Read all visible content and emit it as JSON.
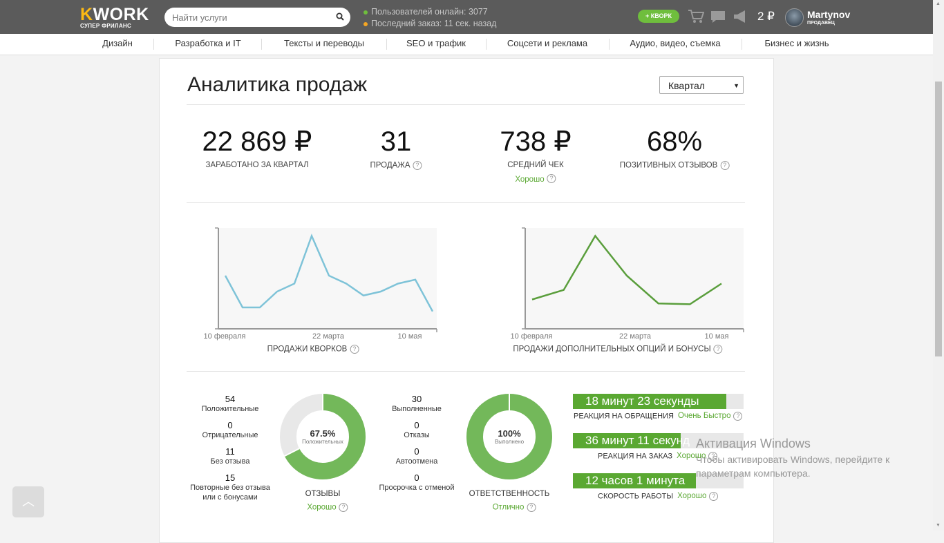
{
  "header": {
    "logo_text": "KWORK",
    "logo_tagline": "СУПЕР ФРИЛАНС",
    "search_placeholder": "Найти услуги",
    "online_text": "Пользователей онлайн: 3077",
    "last_order_text": "Последний заказ: 11 сек. назад",
    "kwork_button": "+ КВОРК",
    "balance": "2 ₽",
    "username": "Martynov",
    "user_role": "ПРОДАВЕЦ",
    "colors": {
      "online_dot": "#6fbe3d",
      "order_dot": "#f5a623",
      "accent": "#6fbe3d"
    }
  },
  "categories": [
    "Дизайн",
    "Разработка и IT",
    "Тексты и переводы",
    "SEO и трафик",
    "Соцсети и реклама",
    "Аудио, видео, съемка",
    "Бизнес и жизнь"
  ],
  "page": {
    "title": "Аналитика продаж",
    "period_select": "Квартал"
  },
  "stats": [
    {
      "value": "22 869 ₽",
      "label": "ЗАРАБОТАНО ЗА КВАРТАЛ",
      "help": false,
      "note": ""
    },
    {
      "value": "31",
      "label": "ПРОДАЖА",
      "help": true,
      "note": ""
    },
    {
      "value": "738 ₽",
      "label": "СРЕДНИЙ ЧЕК",
      "help": false,
      "note": "Хорошо"
    },
    {
      "value": "68%",
      "label": "ПОЗИТИВНЫХ ОТЗЫВОВ",
      "help": true,
      "note": ""
    }
  ],
  "chart_data": [
    {
      "type": "line",
      "title": "ПРОДАЖИ КВОРКОВ",
      "x_tick_labels": [
        "10 февраля",
        "22 марта",
        "10 мая"
      ],
      "values": [
        6,
        2,
        2,
        4,
        5,
        11,
        6,
        5,
        3.5,
        4,
        5,
        5.5,
        1.5
      ],
      "color": "#7ec3d8"
    },
    {
      "type": "line",
      "title": "ПРОДАЖИ ДОПОЛНИТЕЛЬНЫХ ОПЦИЙ И БОНУСЫ",
      "x_tick_labels": [
        "10 февраля",
        "22 марта",
        "10 мая"
      ],
      "values": [
        3,
        4.2,
        11,
        6,
        2.5,
        2.4,
        5
      ],
      "color": "#5a9e3c"
    }
  ],
  "reviews": {
    "items": [
      {
        "value": "54",
        "label": "Положительные"
      },
      {
        "value": "0",
        "label": "Отрицательные"
      },
      {
        "value": "11",
        "label": "Без отзыва"
      },
      {
        "value": "15",
        "label": "Повторные без отзыва",
        "label2": "или с бонусами"
      }
    ],
    "donut_percent": "67.5%",
    "donut_sublabel": "Положительных",
    "donut_fraction": 0.675,
    "caption": "ОТЗЫВЫ",
    "rating": "Хорошо"
  },
  "responsibility": {
    "items": [
      {
        "value": "30",
        "label": "Выполненные"
      },
      {
        "value": "0",
        "label": "Отказы"
      },
      {
        "value": "0",
        "label": "Автоотмена"
      },
      {
        "value": "0",
        "label": "Просрочка с отменой"
      }
    ],
    "donut_percent": "100%",
    "donut_sublabel": "Выполнено",
    "donut_fraction": 1.0,
    "caption": "ОТВЕТСТВЕННОСТЬ",
    "rating": "Отлично"
  },
  "speed": [
    {
      "value": "18 минут 23 секунды",
      "label": "РЕАКЦИЯ НА ОБРАЩЕНИЯ",
      "rating": "Очень Быстро",
      "fill": 0.9
    },
    {
      "value": "36 минут 11 секунд",
      "label": "РЕАКЦИЯ НА ЗАКАЗ",
      "rating": "Хорошо",
      "fill": 0.63
    },
    {
      "value": "12 часов 1 минута",
      "label": "СКОРОСТЬ РАБОТЫ",
      "rating": "Хорошо",
      "fill": 0.72
    }
  ],
  "watermark": {
    "line1": "Активация Windows",
    "line2": "Чтобы активировать Windows, перейдите к",
    "line3": "параметрам компьютера."
  }
}
